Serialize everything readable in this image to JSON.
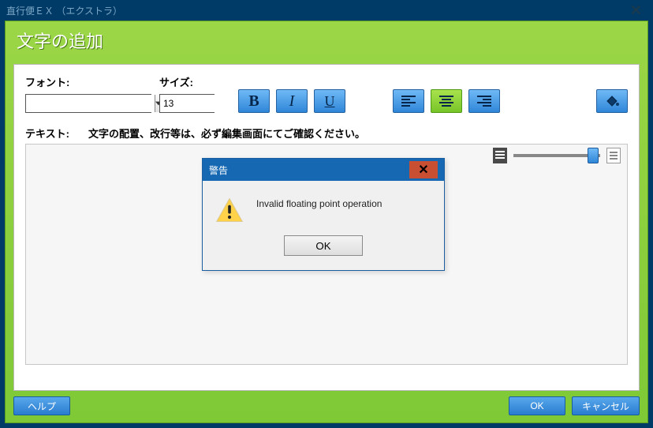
{
  "window": {
    "title": "直行便ＥＸ （エクストラ）"
  },
  "banner": {
    "title": "文字の追加"
  },
  "labels": {
    "font": "フォント:",
    "size": "サイズ:",
    "text": "テキスト:",
    "note": "文字の配置、改行等は、必ず編集画面にてご確認ください。"
  },
  "values": {
    "font": "",
    "size": "13"
  },
  "buttons": {
    "help": "ヘルプ",
    "ok": "OK",
    "cancel": "キャンセル"
  },
  "dialog": {
    "title": "警告",
    "message": "Invalid floating point operation",
    "ok": "OK"
  }
}
